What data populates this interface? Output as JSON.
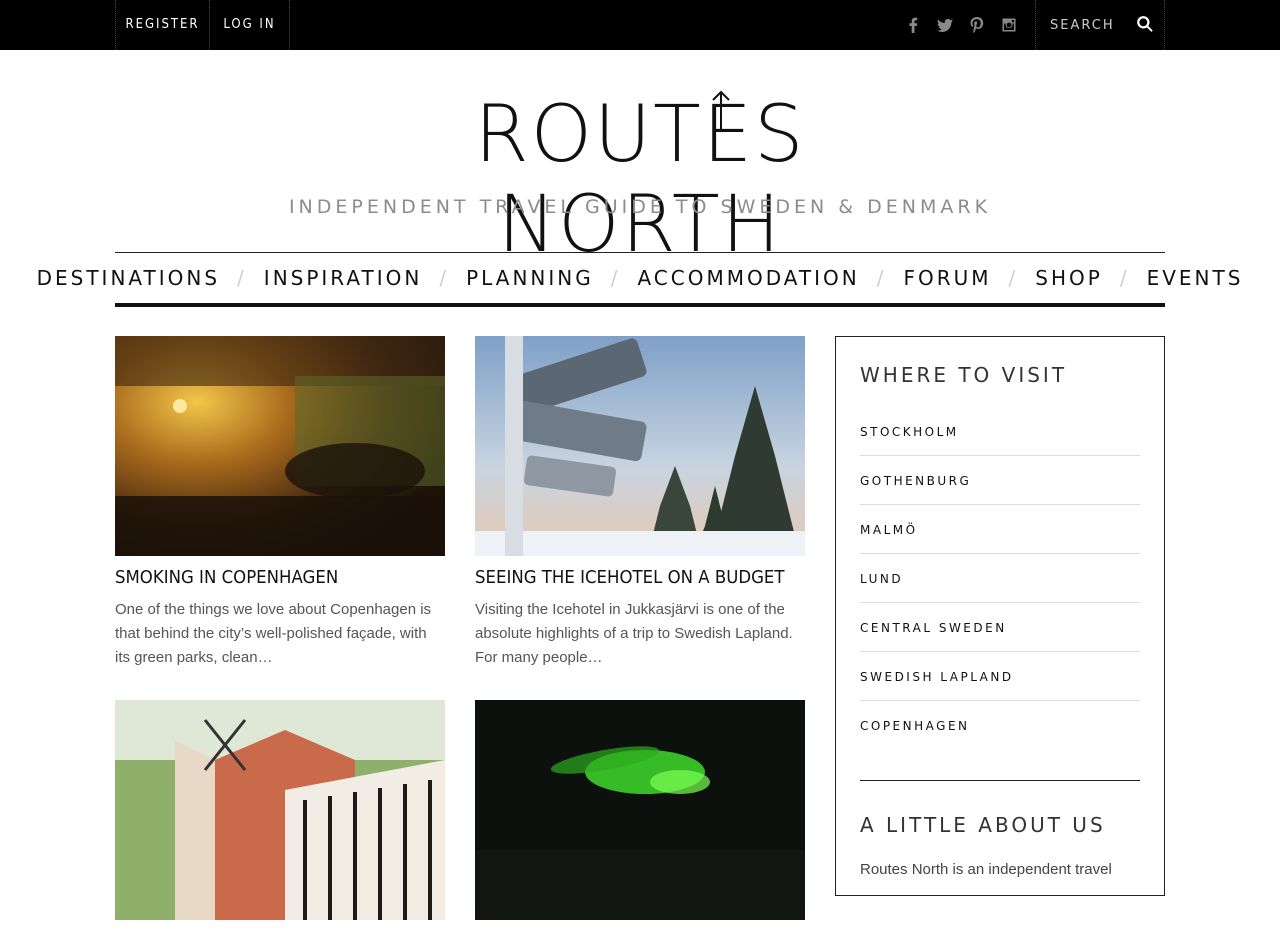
{
  "topbar": {
    "register_label": "REGISTER",
    "login_label": "LOG IN",
    "search_placeholder": "SEARCH",
    "social_icons": [
      "facebook-icon",
      "twitter-icon",
      "pinterest-icon",
      "instagram-icon"
    ]
  },
  "brand": {
    "logo_text": "ROUTES NORTH",
    "tagline": "INDEPENDENT TRAVEL GUIDE TO SWEDEN & DENMARK"
  },
  "nav": {
    "items": [
      "DESTINATIONS",
      "INSPIRATION",
      "PLANNING",
      "ACCOMMODATION",
      "FORUM",
      "SHOP",
      "EVENTS"
    ],
    "separator": "/"
  },
  "posts": [
    {
      "title": "SMOKING IN COPENHAGEN",
      "excerpt": "One of the things we love about Copenhagen is that behind the city’s well-polished façade, with its green parks, clean…"
    },
    {
      "title": "SEEING THE ICEHOTEL ON A BUDGET",
      "excerpt": "Visiting the Icehotel in Jukkasjärvi is one of the absolute highlights of a trip to Swedish Lapland. For many people…"
    },
    {
      "title": "",
      "excerpt": ""
    },
    {
      "title": "",
      "excerpt": ""
    }
  ],
  "sidebar": {
    "where_title": "WHERE TO VISIT",
    "destinations": [
      "STOCKHOLM",
      "GOTHENBURG",
      "MALMÖ",
      "LUND",
      "CENTRAL SWEDEN",
      "SWEDISH LAPLAND",
      "COPENHAGEN"
    ],
    "about_title": "A LITTLE ABOUT US",
    "about_text": "Routes North is an independent travel"
  },
  "colors": {
    "topbar_bg": "#000000",
    "tagline": "#8c8c8c",
    "separator": "#cfcfcf"
  }
}
